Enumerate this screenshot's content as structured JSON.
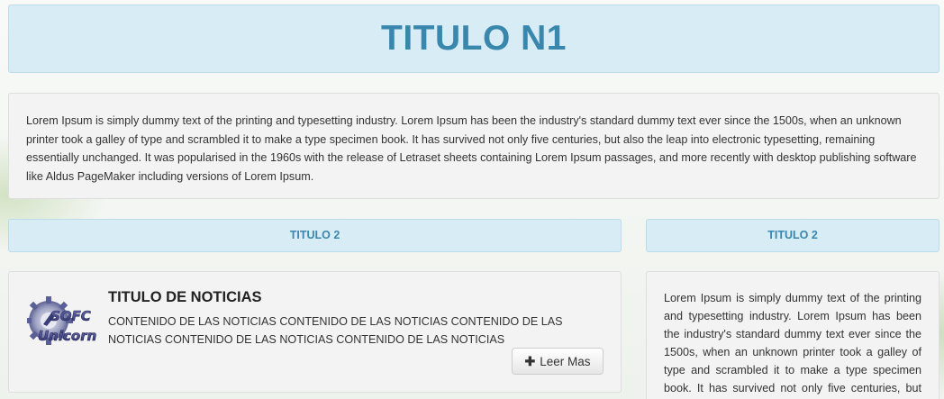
{
  "header": {
    "title": "TITULO N1"
  },
  "intro": {
    "text": "Lorem Ipsum is simply dummy text of the printing and typesetting industry. Lorem Ipsum has been the industry's standard dummy text ever since the 1500s, when an unknown printer took a galley of type and scrambled it to make a type specimen book. It has survived not only five centuries, but also the leap into electronic typesetting, remaining essentially unchanged. It was popularised in the 1960s with the release of Letraset sheets containing Lorem Ipsum passages, and more recently with desktop publishing software like Aldus PageMaker including versions of Lorem Ipsum."
  },
  "main_section": {
    "title": "TITULO 2",
    "news": {
      "logo_icon": "sofc-unicorn-logo",
      "title": "TITULO DE NOTICIAS",
      "content": "CONTENIDO DE LAS NOTICIAS CONTENIDO DE LAS NOTICIAS CONTENIDO DE LAS NOTICIAS CONTENIDO DE LAS NOTICIAS CONTENIDO DE LAS NOTICIAS",
      "read_more_label": "Leer Mas",
      "read_more_icon": "plus-icon"
    }
  },
  "side_section": {
    "title": "TITULO 2",
    "text": "Lorem Ipsum is simply dummy text of the printing and typesetting industry. Lorem Ipsum has been the industry's standard dummy text ever since the 1500s, when an unknown printer took a galley of type and scrambled it to make a type specimen book. It has survived not only five centuries, but also the leap into electronic typesetting."
  },
  "colors": {
    "accent": "#3a87ad",
    "header_bg": "#d8ecf6",
    "panel_bg": "#f3f3f3"
  }
}
